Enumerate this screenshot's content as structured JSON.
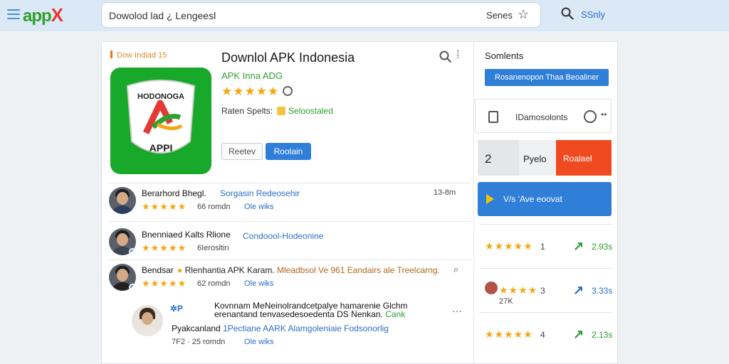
{
  "topbar": {
    "logo_a": "app",
    "logo_b": "X",
    "search_value": "Dowolod lad ¿ Lengeesl",
    "search_button": "Senes",
    "top_link": "SSnly"
  },
  "app": {
    "crumb": "Dow Indiad 15",
    "title": "Downlol APK Indonesia",
    "developer": "APK Inna ADG",
    "rating_stars": "★★★★★",
    "release_label": "Raten Spelts:",
    "release_value": "Seloostaled",
    "btn_review": "Reetev",
    "btn_install": "Roolain",
    "icon_text_top": "HODONOGA",
    "icon_text_bottom": "APPI"
  },
  "reviews": [
    {
      "name": "Berarhord Bhegl.",
      "tag": "Sorgasin Redeosehir",
      "time": "13-8m",
      "stars": "★★★★★",
      "meta": "66 romdn",
      "link": "Ole wiks"
    },
    {
      "name": "Bnenniaed Kalts Rlione",
      "tag": "Condoool-Hodeonine",
      "stars": "★★★★★",
      "meta": "6Ierosltin"
    },
    {
      "name": "Bendsar",
      "tag_a": "Rlenhantia APK Karam.",
      "tag_b": "Mleadbsol Ve 961 Eandairs ale Treelcarng.",
      "stars": "★★★★★",
      "meta": "62 romdn",
      "link": "Ole wiks"
    },
    {
      "name_a": "Kovnnam MeNeinolrandcetpalye hamarenie Glchm",
      "name_b": "erenantand tenvasedesoedenta DS Nenkan.",
      "tag_inline": "Cank",
      "line2_a": "Pyakcanland",
      "line2_b": "1Pectiane AARK Alamgoleniaie Fodsonorlig",
      "meta": "7F2 · 25 romdn",
      "link": "Ole wiks"
    }
  ],
  "side": {
    "title": "Somlents",
    "blue_bar": "Rosanenopon Thaa Beoaliner",
    "box_label": "IDamosolonts",
    "split_num": "2",
    "split_mid": "Pyelo",
    "split_red": "Roalael",
    "play_label": "V/s 'Ave eoovat",
    "ranks": [
      {
        "stars": "★★★★★",
        "num": "1",
        "val": "2.93s"
      },
      {
        "stars": "★★★★",
        "num": "3",
        "val": "3.33s",
        "sub": "27K"
      },
      {
        "stars": "★★★★★",
        "num": "4",
        "val": "2.13s"
      }
    ]
  },
  "colors": {
    "accent_blue": "#2f7fd8",
    "brand_green": "#18a82a",
    "cta_red": "#f04a20",
    "star_gold": "#f3a712"
  }
}
